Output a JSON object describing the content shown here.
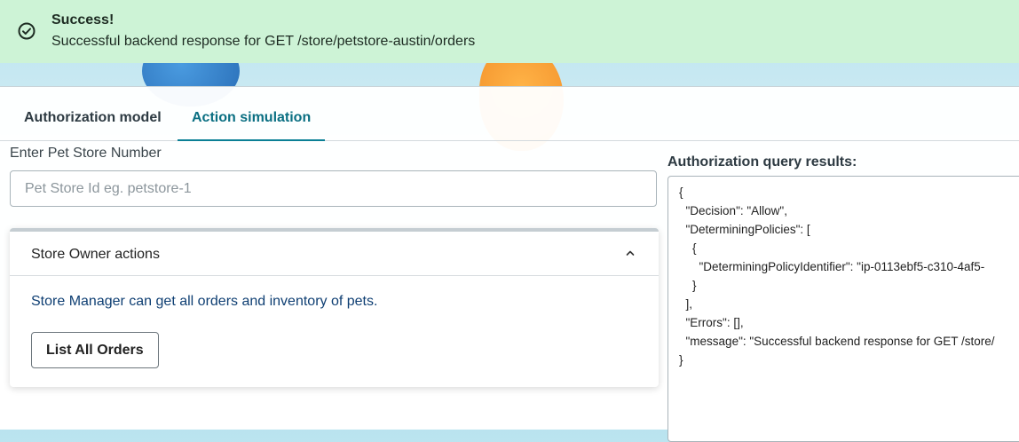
{
  "toast": {
    "icon": "check-circle-icon",
    "title": "Success!",
    "message": "Successful backend response for GET /store/petstore-austin/orders",
    "background": "#cdf3d6"
  },
  "tabs": [
    {
      "label": "Authorization model",
      "active": false
    },
    {
      "label": "Action simulation",
      "active": true
    }
  ],
  "store_input": {
    "label": "Enter Pet Store Number",
    "placeholder": "Pet Store Id eg. petstore-1",
    "value": ""
  },
  "accordion": {
    "title": "Store Owner actions",
    "expanded": true,
    "chevron_icon": "chevron-up-icon",
    "description": "Store Manager can get all orders and inventory of pets.",
    "button_label": "List All Orders"
  },
  "results": {
    "label": "Authorization query results:",
    "lines": [
      "{",
      "  \"Decision\": \"Allow\",",
      "  \"DeterminingPolicies\": [",
      "    {",
      "      \"DeterminingPolicyIdentifier\": \"ip-0113ebf5-c310-4af5-",
      "    }",
      "  ],",
      "  \"Errors\": [],",
      "  \"message\": \"Successful backend response for GET /store/",
      "}"
    ]
  },
  "colors": {
    "accent": "#0a7f95",
    "link_text": "#0f3f73"
  }
}
